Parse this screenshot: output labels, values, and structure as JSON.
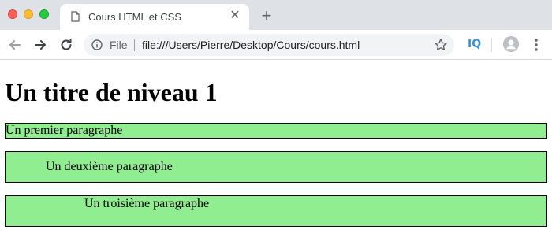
{
  "browser": {
    "tab": {
      "title": "Cours HTML et CSS"
    },
    "newtab_label": "+",
    "address_bar": {
      "scheme_label": "File",
      "url": "file:///Users/Pierre/Desktop/Cours/cours.html"
    },
    "extension_label": "IQ",
    "close_glyph": "✕"
  },
  "page": {
    "heading": "Un titre de niveau 1",
    "paragraphs": [
      "Un premier paragraphe",
      "Un deuxième paragraphe",
      "Un troisième paragraphe"
    ]
  },
  "colors": {
    "paragraph_background": "#90ee90",
    "tabstrip": "#dee1e6"
  }
}
